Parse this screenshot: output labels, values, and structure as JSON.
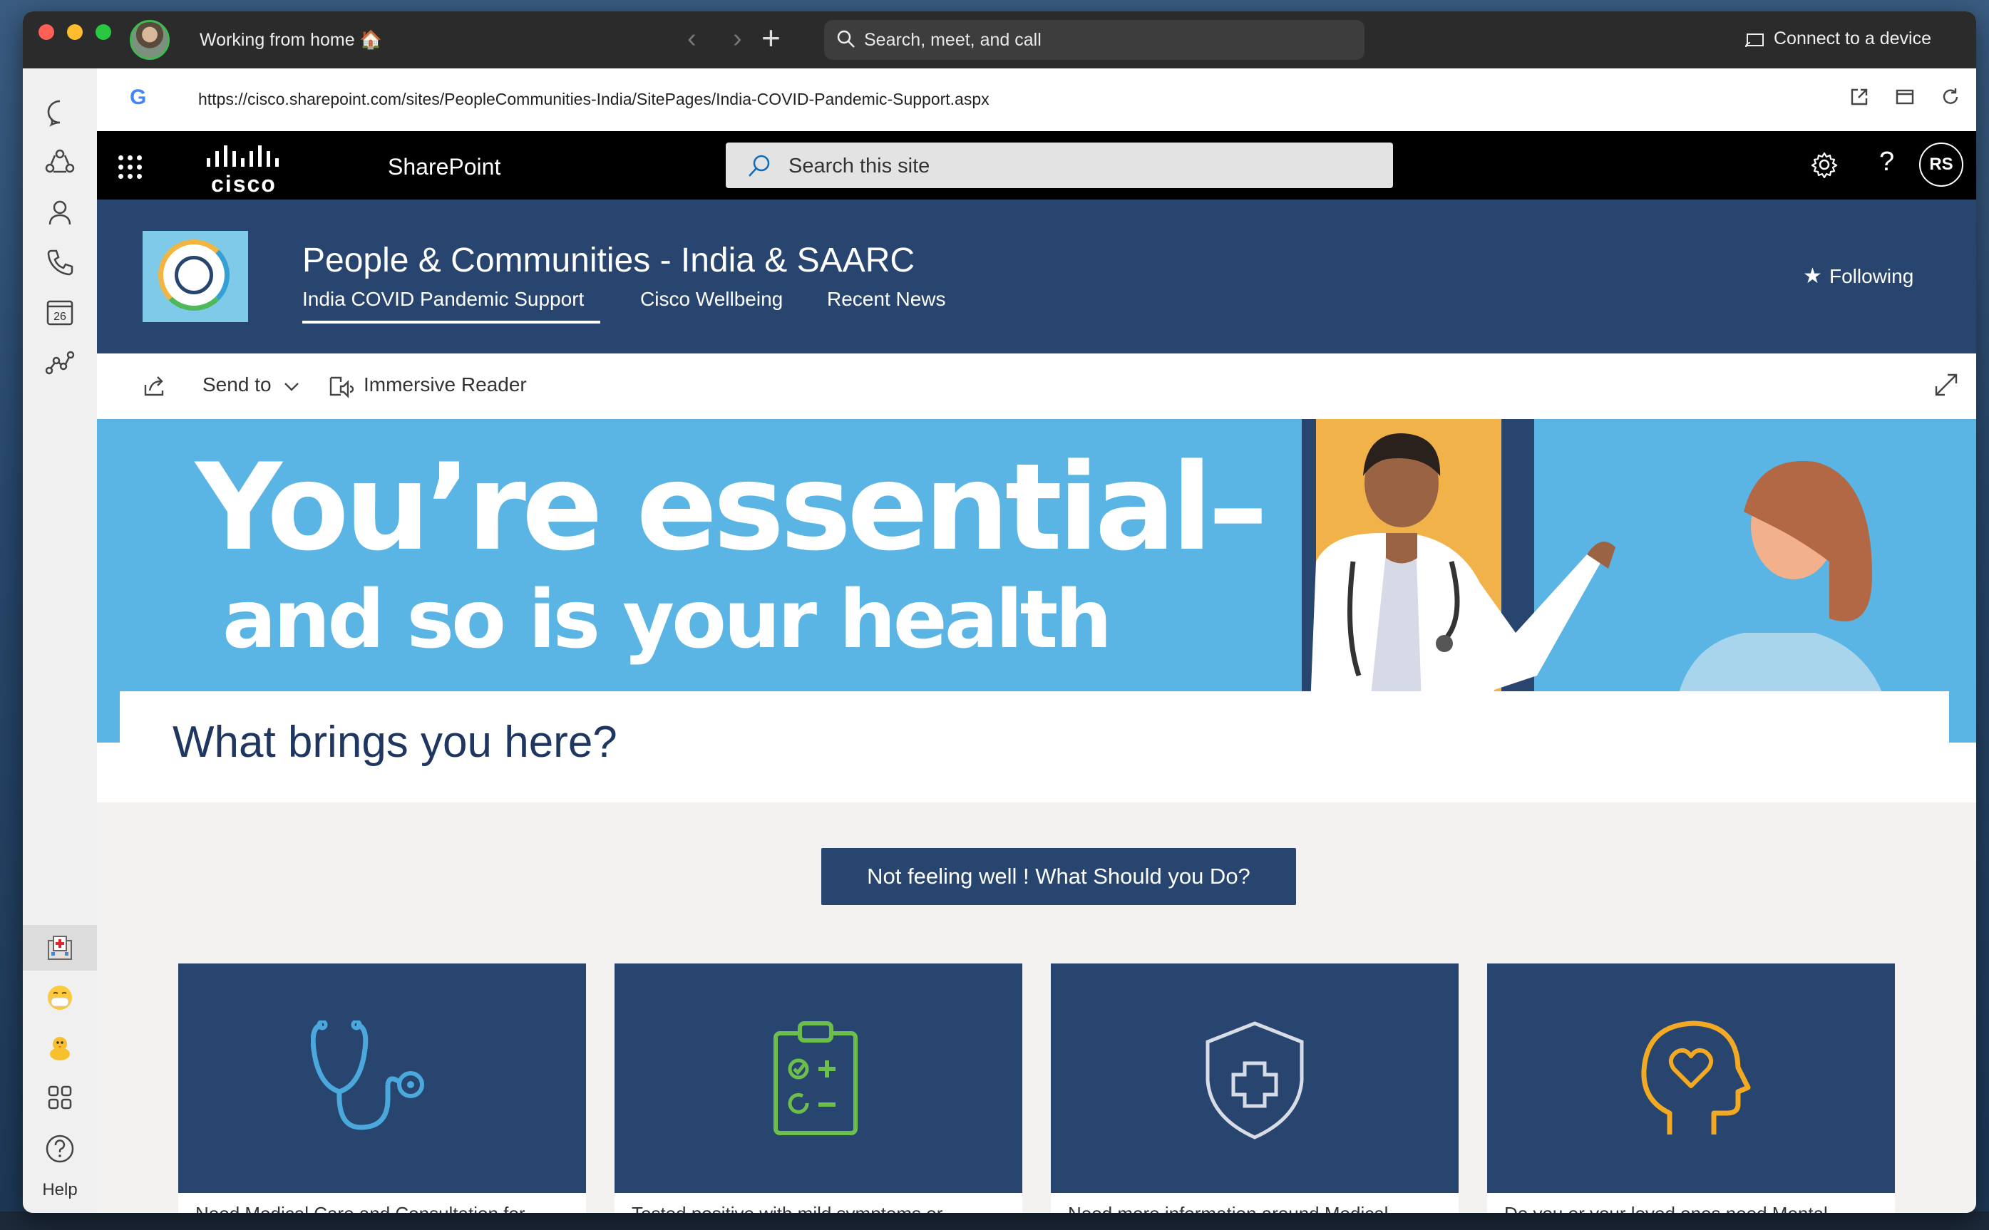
{
  "window": {
    "status_text": "Working from home 🏠",
    "search_placeholder": "Search, meet, and call",
    "connect_label": "Connect to a device",
    "avatar_icon": "user-avatar"
  },
  "rail": {
    "items": [
      "chat-icon",
      "teams-icon",
      "people-icon",
      "calls-icon",
      "calendar-icon",
      "workflow-icon",
      "hospital-icon",
      "mask-emoji-icon",
      "chick-emoji-icon",
      "apps-icon",
      "help-icon"
    ],
    "calendar_day": "26",
    "help_label": "Help"
  },
  "browser": {
    "url": "https://cisco.sharepoint.com/sites/PeopleCommunities-India/SitePages/India-COVID-Pandemic-Support.aspx",
    "google_letter": "G"
  },
  "suitebar": {
    "brand": "cisco",
    "app_name": "SharePoint",
    "search_placeholder": "Search this site",
    "user_initials": "RS",
    "help_glyph": "?"
  },
  "site": {
    "title": "People & Communities - India & SAARC",
    "nav": [
      "India COVID Pandemic Support",
      "Cisco Wellbeing",
      "Recent News"
    ],
    "following_label": "Following"
  },
  "commandbar": {
    "send_to": "Send to",
    "immersive_reader": "Immersive Reader"
  },
  "hero": {
    "line1": "You’re essential–",
    "line2": "and so is your health"
  },
  "main": {
    "heading": "What brings you here?",
    "cta_label": "Not feeling well ! What Should you Do?",
    "tiles": [
      {
        "icon": "stethoscope-icon",
        "caption": "Need Medical Care and Consultation for..."
      },
      {
        "icon": "clipboard-icon",
        "caption": "Tested positive with mild symptoms or..."
      },
      {
        "icon": "shield-cross-icon",
        "caption": "Need more information around Medical..."
      },
      {
        "icon": "head-heart-icon",
        "caption": "Do you or your loved ones need Mental..."
      }
    ]
  },
  "colors": {
    "sharepoint_theme": "#27456e",
    "hero_blue": "#5ab4e4",
    "tile_blue_icon": "#4aa8dc",
    "tile_green_icon": "#6cbf4a",
    "tile_orange_icon": "#f3a922"
  }
}
